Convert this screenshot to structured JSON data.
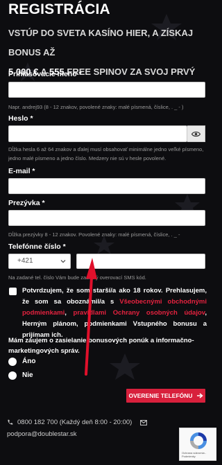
{
  "header": {
    "title": "REGISTRÁCIA",
    "subtitle_line1": "VSTÚP DO SVETA KASÍNO HIER, A ZÍSKAJ BONUS AŽ",
    "bonus_amount": "5 000 €",
    "and": "A",
    "spins": "555",
    "subtitle_line2_rest": "FREE SPINOV ZA SVOJ PRVÝ VKLAD!"
  },
  "form": {
    "username": {
      "label": "Prihlasovacie meno *",
      "value": "",
      "hint": "Napr. andrej93 (8 - 12 znakov, povolené znaky: malé písmená, číslice, . _ - )"
    },
    "password": {
      "label": "Heslo *",
      "value": "",
      "hint": "Dĺžka hesla 6 až 64 znakov a ďalej musí obsahovať minimálne jedno veľké písmeno, jedno malé písmeno a jedno číslo. Medzery nie sú v hesle povolené."
    },
    "email": {
      "label": "E-mail *",
      "value": ""
    },
    "nickname": {
      "label": "Prezývka *",
      "value": "",
      "hint": "Dĺžka prezývky 8 - 12 znakov. Povolené znaky: malé písmená, číslice, . _ -"
    },
    "phone": {
      "label": "Telefónne číslo *",
      "prefix": "+421",
      "value": "",
      "hint": "Na zadané tel. číslo Vám bude zaslaný overovací SMS kód."
    },
    "consent": {
      "part1": "Potvrdzujem, že som starší/a ako 18 rokov. Prehlasujem, že som sa oboznámil/a s ",
      "link1": "Všeobecnými obchodnými podmienkami",
      "sep1": ", ",
      "link2": "pravidlami Ochrany osobných údajov",
      "part2": ", Herným plánom, podmienkami Vstupného bonusu a prijímam ich."
    },
    "marketing": {
      "question": "Mám záujem o zasielanie bonusových ponúk a informačno-marketingových správ.",
      "option_yes": "Áno",
      "option_no": "Nie"
    },
    "verify_button": "OVERENIE TELEFÓNU"
  },
  "contact": {
    "phone": "0800 182 700 (Každý deň 8:00 - 20:00)",
    "email": "podpora@doublestar.sk"
  },
  "recaptcha": {
    "note": "Ochrana súkromia - Podmienky"
  },
  "colors": {
    "accent": "#e5223f",
    "button": "#d8203c",
    "background": "#0d0d10",
    "arrow": "#e0102b"
  }
}
